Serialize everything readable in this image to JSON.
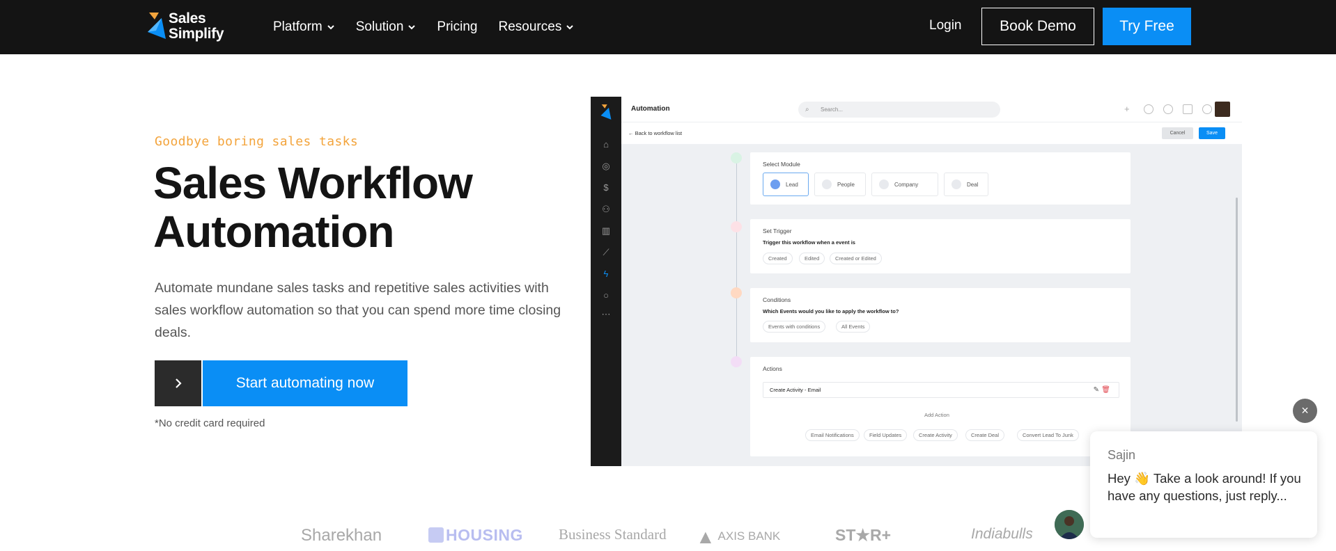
{
  "nav": {
    "logo_line1": "Sales",
    "logo_line2": "Simplify",
    "links": [
      "Platform",
      "Solution",
      "Pricing",
      "Resources"
    ],
    "login": "Login",
    "book_demo": "Book Demo",
    "try_free": "Try Free"
  },
  "hero": {
    "eyebrow": "Goodbye boring sales tasks",
    "title": "Sales Workflow Automation",
    "description": "Automate mundane sales tasks and repetitive sales activities with sales workflow automation so that you can spend more time closing deals.",
    "cta": "Start automating now",
    "note": "*No credit card required"
  },
  "mock": {
    "title": "Automation",
    "search_placeholder": "Search...",
    "back": "← Back to workflow list",
    "cancel": "Cancel",
    "save": "Save",
    "module": {
      "title": "Select Module",
      "options": [
        "Lead",
        "People",
        "Company",
        "Deal"
      ]
    },
    "trigger": {
      "title": "Set Trigger",
      "question": "Trigger this workflow when a event is",
      "options": [
        "Created",
        "Edited",
        "Created or Edited"
      ]
    },
    "conditions": {
      "title": "Conditions",
      "question": "Which Events would you like to apply the workflow to?",
      "options": [
        "Events with conditions",
        "All Events"
      ]
    },
    "actions": {
      "title": "Actions",
      "row": "Create Activity - Email",
      "add": "Add Action",
      "options": [
        "Email Notifications",
        "Field Updates",
        "Create Activity",
        "Create Deal",
        "Convert Lead To Junk"
      ]
    }
  },
  "clients": [
    "Sharekhan",
    "HOUSING",
    "Business Standard",
    "AXIS BANK",
    "ST★R+",
    "Indiabulls"
  ],
  "chat": {
    "close": "×",
    "name": "Sajin",
    "message": "Hey 👋 Take a look around! If you have any questions, just reply..."
  },
  "colors": {
    "brand_blue": "#0a8ef5",
    "nav_bg": "#141414",
    "eyebrow": "#f3a43c"
  }
}
